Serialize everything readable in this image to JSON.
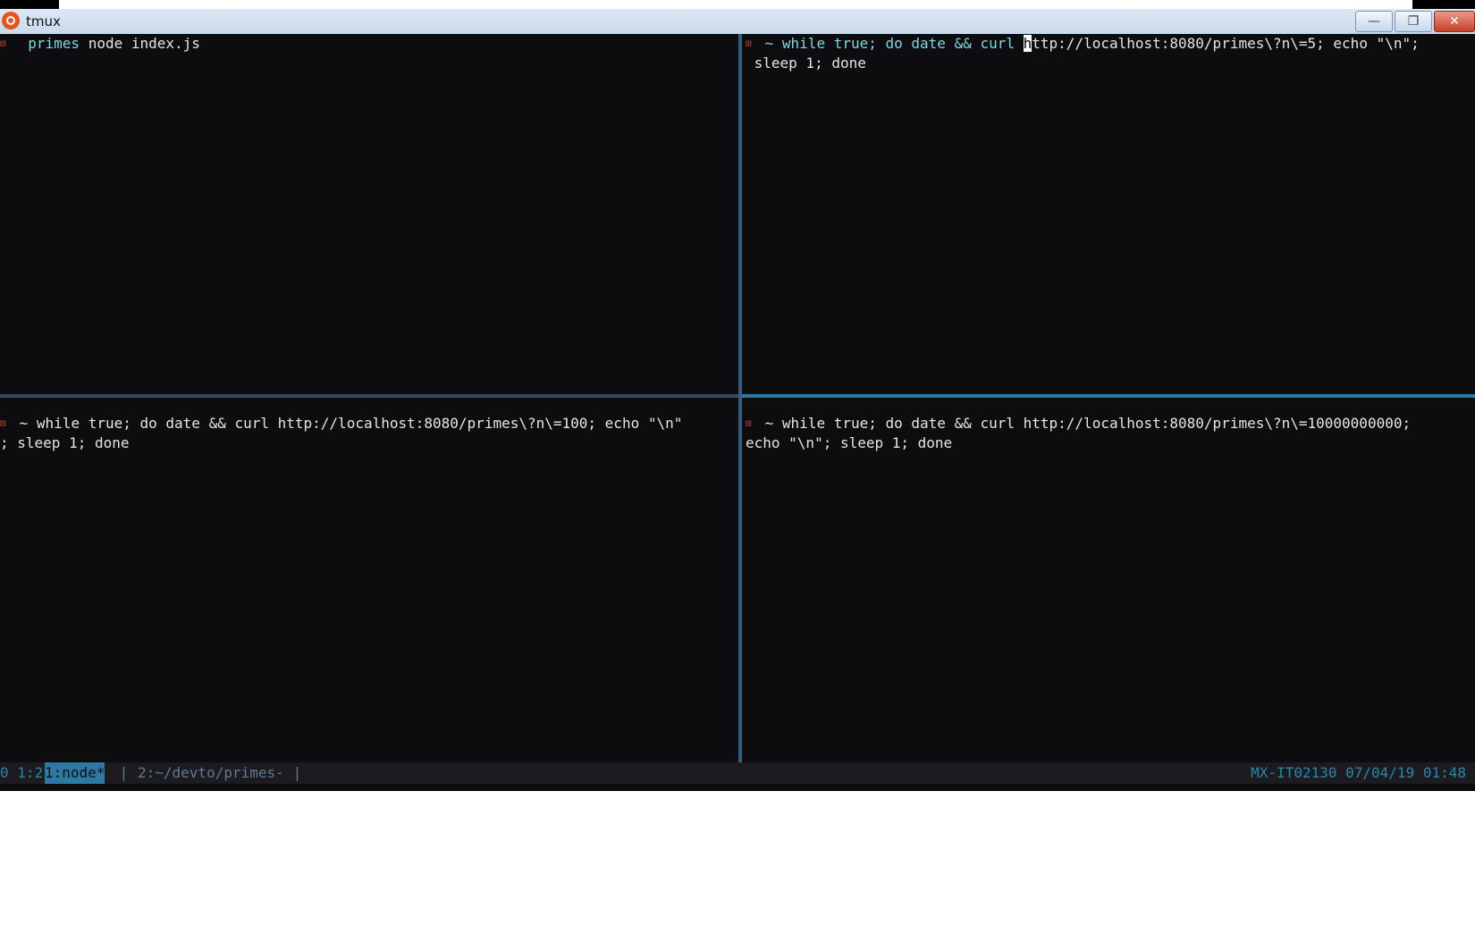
{
  "window": {
    "title": "tmux"
  },
  "panes": {
    "p1": {
      "dir": "primes",
      "command": " node index.js"
    },
    "p2": {
      "line1_pre": "~ while true; do date && curl ",
      "line1_cursor": "h",
      "line1_post": "ttp://localhost:8080/primes\\?n\\=5; echo \"\\n\";",
      "line2": " sleep 1; done"
    },
    "p3": {
      "line1": "~ while true; do date && curl http://localhost:8080/primes\\?n\\=100; echo \"\\n\"",
      "line2": "; sleep 1; done"
    },
    "p4": {
      "line1": "~ while true; do date && curl http://localhost:8080/primes\\?n\\=10000000000;",
      "line2": "echo \"\\n\"; sleep 1; done"
    }
  },
  "status": {
    "session": "0 1:2",
    "current_window": "1:node*",
    "separator1": " | ",
    "other_window": "2:~/devto/primes-",
    "separator2": " |",
    "right": "MX-IT02130 07/04/19 01:48"
  },
  "icons": {
    "pane_badge": "⊡"
  },
  "colors": {
    "terminal_bg": "#0d0d10",
    "accent": "#2c84ab",
    "badge": "#e04848"
  }
}
